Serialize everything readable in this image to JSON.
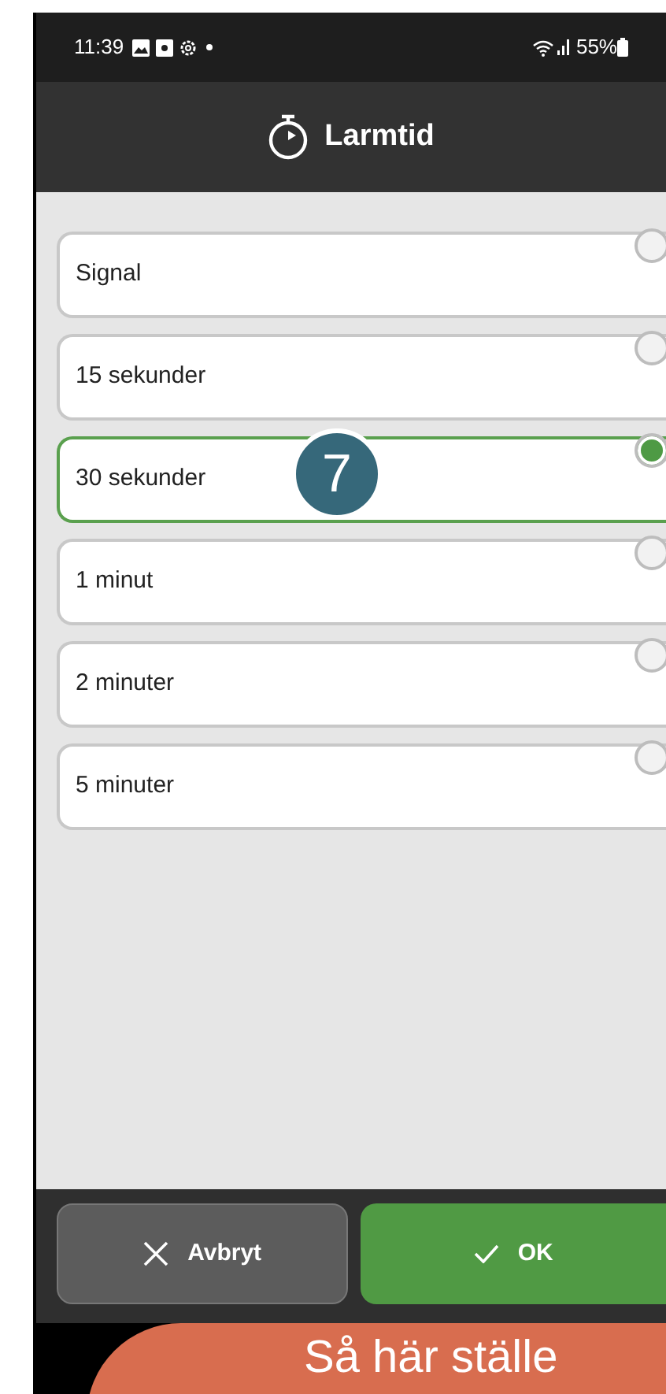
{
  "status_bar": {
    "time": "11:39",
    "battery_text": "55%"
  },
  "header": {
    "title": "Larmtid"
  },
  "options": [
    {
      "label": "Signal",
      "selected": false
    },
    {
      "label": "15 sekunder",
      "selected": false
    },
    {
      "label": "30 sekunder",
      "selected": true
    },
    {
      "label": "1 minut",
      "selected": false
    },
    {
      "label": "2 minuter",
      "selected": false
    },
    {
      "label": "5 minuter",
      "selected": false
    }
  ],
  "step_badge": {
    "text": "7"
  },
  "buttons": [
    {
      "kind": "cancel",
      "label": "Avbryt"
    },
    {
      "kind": "ok",
      "label": "OK"
    }
  ],
  "banner": {
    "text": "Så här ställe"
  }
}
